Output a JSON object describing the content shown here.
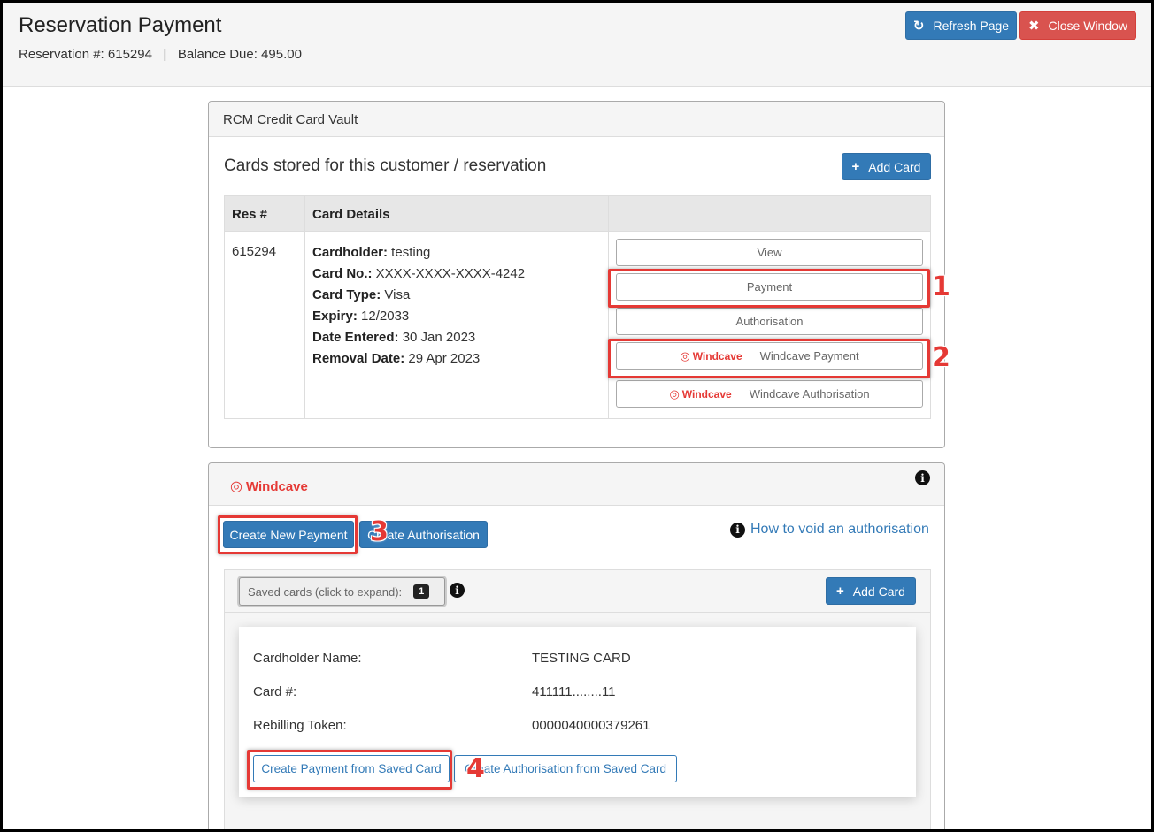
{
  "header": {
    "title": "Reservation Payment",
    "reservation_line": "Reservation #: 615294   |   Balance Due: 495.00",
    "refresh_label": "Refresh Page",
    "close_label": "Close Window"
  },
  "vault": {
    "heading": "RCM Credit Card Vault",
    "title": "Cards stored for this customer / reservation",
    "add_card_label": "Add Card",
    "columns": [
      "Res #",
      "Card Details",
      ""
    ],
    "row": {
      "res": "615294",
      "details": [
        {
          "label": "Cardholder:",
          "value": " testing"
        },
        {
          "label": "Card No.:",
          "value": " XXXX-XXXX-XXXX-4242"
        },
        {
          "label": "Card Type:",
          "value": " Visa"
        },
        {
          "label": "Expiry:",
          "value": " 12/2033"
        },
        {
          "label": "Date Entered:",
          "value": " 30 Jan 2023"
        },
        {
          "label": "Removal Date:",
          "value": " 29 Apr 2023"
        }
      ],
      "actions": {
        "view": "View",
        "payment": "Payment",
        "authorisation": "Authorisation",
        "windcave_payment": "Windcave Payment",
        "windcave_authorisation": "Windcave Authorisation"
      }
    }
  },
  "windcave": {
    "logo": "Windcave",
    "create_payment_label": "Create New Payment",
    "create_auth_label": "Create Authorisation",
    "void_link": "How to void an authorisation",
    "saved_toggle_label": "Saved cards (click to expand):",
    "saved_count": "1",
    "add_card_label": "Add Card",
    "saved_card": {
      "name_label": "Cardholder Name:",
      "name_value": "TESTING CARD",
      "number_label": "Card #:",
      "number_value": "411111........11",
      "token_label": "Rebilling Token:",
      "token_value": "0000040000379261",
      "pay_label": "Create Payment from Saved Card",
      "auth_label": "Create Authorisation from Saved Card"
    }
  },
  "annotations": [
    "1",
    "2",
    "3",
    "4"
  ],
  "colors": {
    "primary": "#337ab7",
    "danger": "#d9534f",
    "windcave_red": "#e53935",
    "annotation": "#e53935"
  },
  "icons": {
    "refresh": "refresh-icon",
    "close": "close-icon",
    "plus": "plus-icon",
    "info": "info-icon",
    "windcave": "windcave-logo-icon"
  }
}
